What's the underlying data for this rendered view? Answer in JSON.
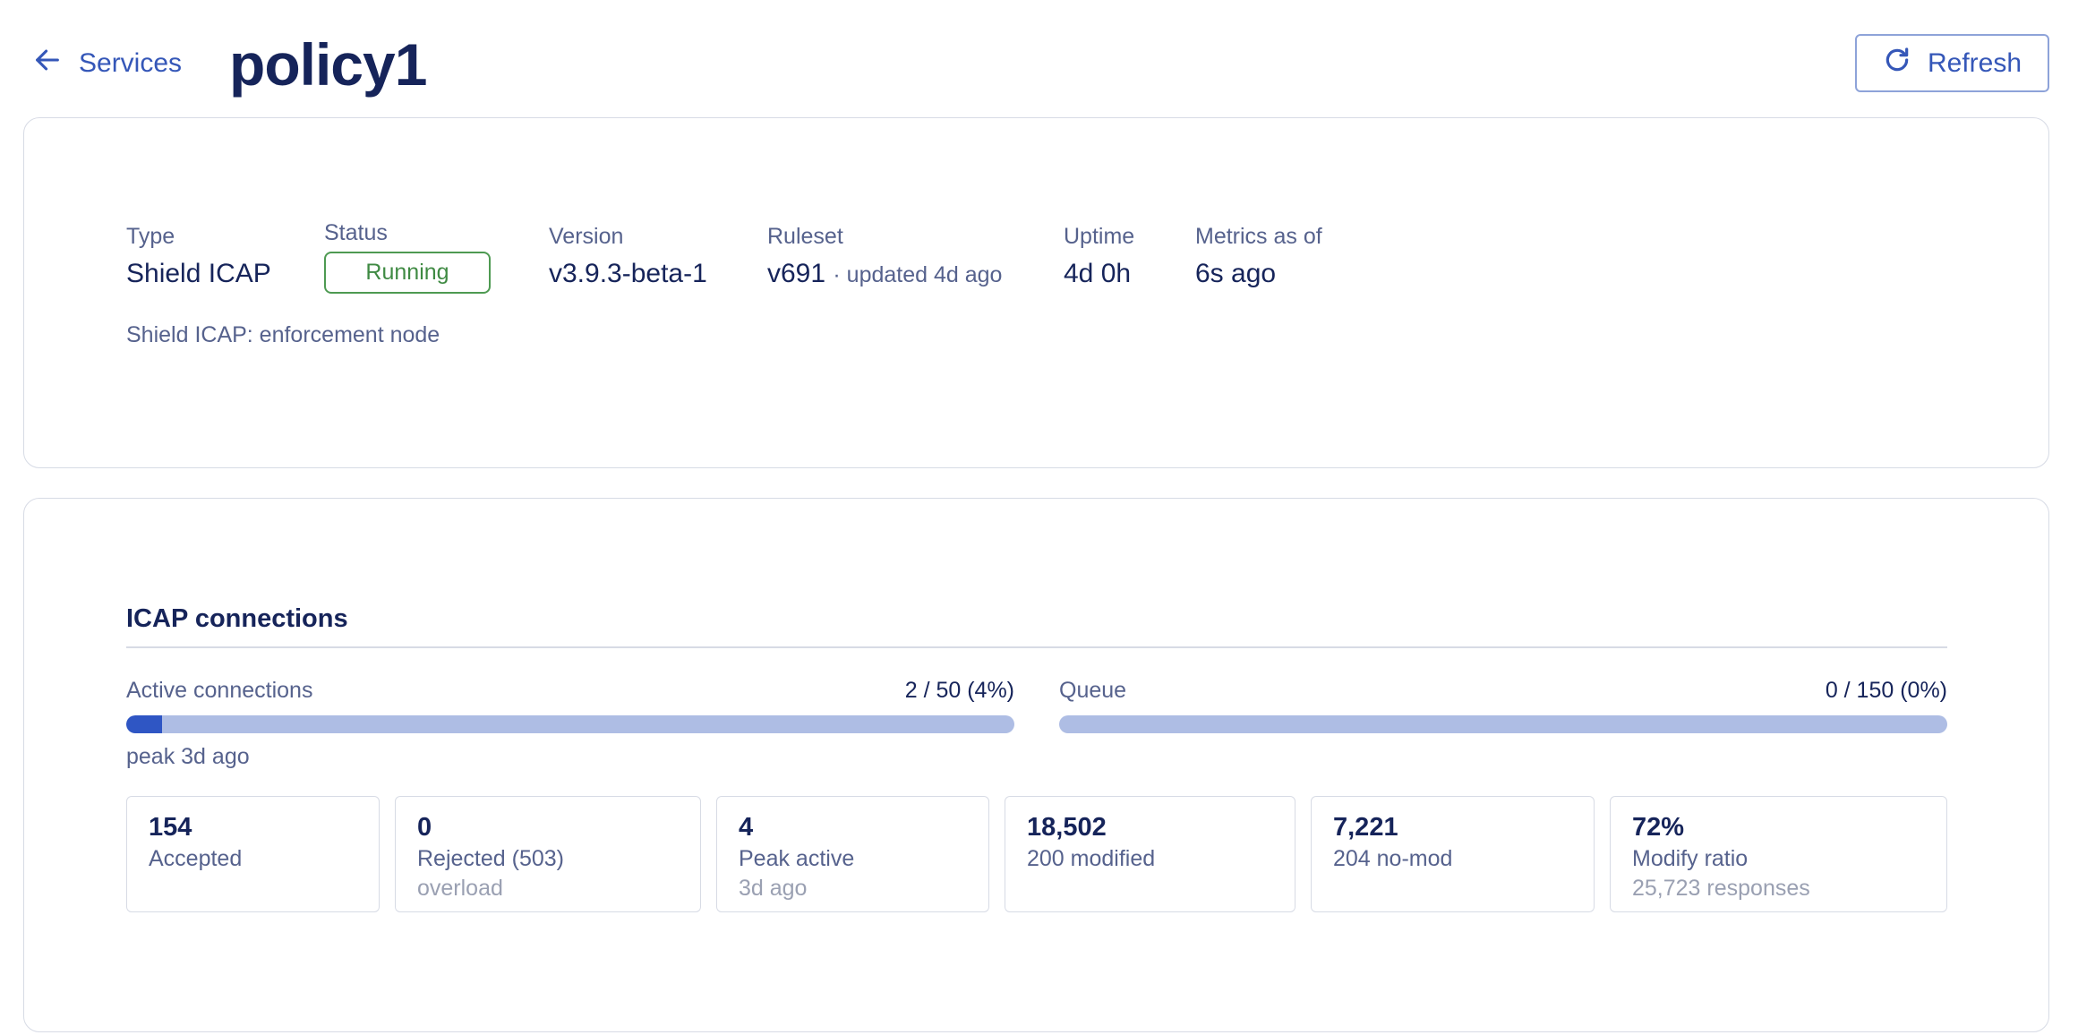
{
  "header": {
    "back_label": "Services",
    "title": "policy1",
    "refresh_label": "Refresh"
  },
  "info": {
    "type": {
      "label": "Type",
      "value": "Shield ICAP"
    },
    "status": {
      "label": "Status",
      "value": "Running",
      "color": "#3f8a43"
    },
    "version": {
      "label": "Version",
      "value": "v3.9.3-beta-1"
    },
    "ruleset": {
      "label": "Ruleset",
      "value": "v691",
      "sub": "· updated 4d ago"
    },
    "uptime": {
      "label": "Uptime",
      "value": "4d 0h"
    },
    "metrics": {
      "label": "Metrics as of",
      "value": "6s ago"
    },
    "description": "Shield ICAP: enforcement node"
  },
  "icap": {
    "title": "ICAP connections",
    "active": {
      "label": "Active connections",
      "value": "2 / 50 (4%)",
      "fraction": 0.04,
      "note": "peak 3d ago"
    },
    "queue": {
      "label": "Queue",
      "value": "0 / 150 (0%)",
      "fraction": 0
    },
    "stats": [
      {
        "value": "154",
        "label": "Accepted",
        "sub": ""
      },
      {
        "value": "0",
        "label": "Rejected (503)",
        "sub": "overload"
      },
      {
        "value": "4",
        "label": "Peak active",
        "sub": "3d ago"
      },
      {
        "value": "18,502",
        "label": "200 modified",
        "sub": ""
      },
      {
        "value": "7,221",
        "label": "204 no-mod",
        "sub": ""
      },
      {
        "value": "72%",
        "label": "Modify ratio",
        "sub": "25,723 responses"
      }
    ]
  },
  "colors": {
    "accent": "#3557b8",
    "meter_fill": "#2f56c4",
    "meter_track": "#aebde4",
    "running": "#3f8a43"
  },
  "icons": {
    "back": "arrow-left-icon",
    "refresh": "refresh-icon"
  }
}
